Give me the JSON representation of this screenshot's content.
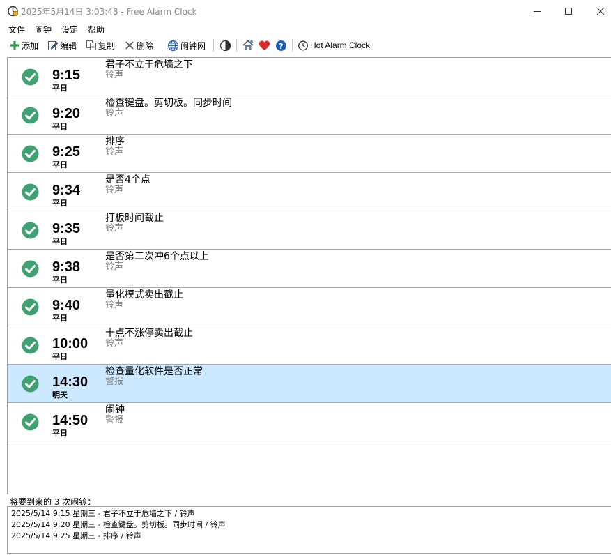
{
  "window": {
    "title": "2025年5月14日 3:03:48 - Free Alarm Clock"
  },
  "menu": {
    "items": [
      "文件",
      "闹钟",
      "设定",
      "帮助"
    ]
  },
  "toolbar": {
    "add_label": "添加",
    "edit_label": "编辑",
    "copy_label": "复制",
    "delete_label": "删除",
    "web_label": "闹钟网",
    "hot_label": "Hot Alarm Clock"
  },
  "colors": {
    "check": "#3fa072",
    "add": "#2e9b47",
    "heart": "#d92b2b",
    "help": "#1f5fb7",
    "selected_row": "#cce8ff"
  },
  "alarms": [
    {
      "time": "9:15",
      "repeat": "平日",
      "label": "君子不立于危墙之下",
      "sound": "铃声",
      "enabled": true,
      "selected": false
    },
    {
      "time": "9:20",
      "repeat": "平日",
      "label": "检查键盘。剪切板。同步时间",
      "sound": "铃声",
      "enabled": true,
      "selected": false
    },
    {
      "time": "9:25",
      "repeat": "平日",
      "label": "排序",
      "sound": "铃声",
      "enabled": true,
      "selected": false
    },
    {
      "time": "9:34",
      "repeat": "平日",
      "label": "是否4个点",
      "sound": "铃声",
      "enabled": true,
      "selected": false
    },
    {
      "time": "9:35",
      "repeat": "平日",
      "label": "打板时间截止",
      "sound": "铃声",
      "enabled": true,
      "selected": false
    },
    {
      "time": "9:38",
      "repeat": "平日",
      "label": "是否第二次冲6个点以上",
      "sound": "铃声",
      "enabled": true,
      "selected": false
    },
    {
      "time": "9:40",
      "repeat": "平日",
      "label": "量化模式卖出截止",
      "sound": "铃声",
      "enabled": true,
      "selected": false
    },
    {
      "time": "10:00",
      "repeat": "平日",
      "label": "十点不涨停卖出截止",
      "sound": "铃声",
      "enabled": true,
      "selected": false
    },
    {
      "time": "14:30",
      "repeat": "明天",
      "label": "检查量化软件是否正常",
      "sound": "警报",
      "enabled": true,
      "selected": true
    },
    {
      "time": "14:50",
      "repeat": "平日",
      "label": "闹钟",
      "sound": "警报",
      "enabled": true,
      "selected": false
    }
  ],
  "upcoming": {
    "title": "将要到来的 3 次闹铃：",
    "lines": [
      "2025/5/14 9:15 星期三 - 君子不立于危墙之下 / 铃声",
      "2025/5/14 9:20 星期三 - 检查键盘。剪切板。同步时间 / 铃声",
      "2025/5/14 9:25 星期三 - 排序 / 铃声"
    ]
  }
}
